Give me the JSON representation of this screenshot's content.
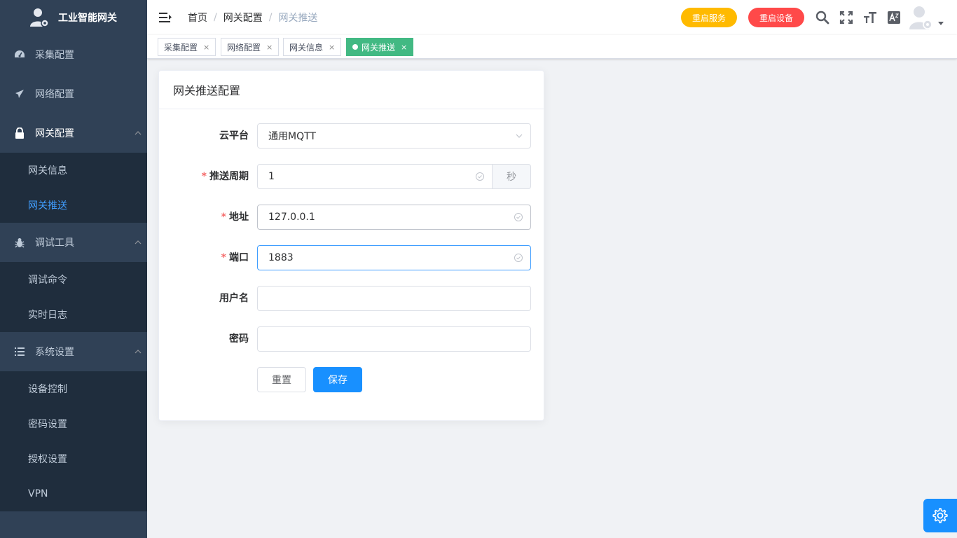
{
  "app": {
    "title": "工业智能网关"
  },
  "sidebar": {
    "items": [
      {
        "label": "采集配置",
        "icon": "dashboard-icon"
      },
      {
        "label": "网络配置",
        "icon": "paper-plane-icon"
      },
      {
        "label": "网关配置",
        "icon": "lock-icon",
        "expanded": true,
        "children": [
          {
            "label": "网关信息"
          },
          {
            "label": "网关推送",
            "active": true
          }
        ]
      },
      {
        "label": "调试工具",
        "icon": "bug-icon",
        "expanded": true,
        "children": [
          {
            "label": "调试命令"
          },
          {
            "label": "实时日志"
          }
        ]
      },
      {
        "label": "系统设置",
        "icon": "list-icon",
        "expanded": true,
        "children": [
          {
            "label": "设备控制"
          },
          {
            "label": "密码设置"
          },
          {
            "label": "授权设置"
          },
          {
            "label": "VPN"
          }
        ]
      }
    ]
  },
  "navbar": {
    "breadcrumb": [
      "首页",
      "网关配置",
      "网关推送"
    ],
    "restart_service": "重启服务",
    "restart_device": "重启设备",
    "tools": [
      "search-icon",
      "fullscreen-icon",
      "font-size-icon",
      "translate-icon"
    ]
  },
  "tags": [
    {
      "label": "采集配置",
      "close": "×"
    },
    {
      "label": "网络配置",
      "close": "×"
    },
    {
      "label": "网关信息",
      "close": "×"
    },
    {
      "label": "网关推送",
      "close": "×",
      "active": true
    }
  ],
  "form": {
    "title": "网关推送配置",
    "cloud": {
      "label": "云平台",
      "value": "通用MQTT"
    },
    "period": {
      "label": "推送周期",
      "value": "1",
      "unit": "秒"
    },
    "address": {
      "label": "地址",
      "value": "127.0.0.1"
    },
    "port": {
      "label": "端口",
      "value": "1883"
    },
    "username": {
      "label": "用户名",
      "value": ""
    },
    "password": {
      "label": "密码",
      "value": ""
    },
    "reset_label": "重置",
    "save_label": "保存",
    "required_mark": "*"
  },
  "colors": {
    "sidebar_bg": "#304156",
    "submenu_bg": "#1f2d3d",
    "active_link": "#409eff",
    "primary": "#1890ff",
    "warning": "#ffba00",
    "danger": "#ff4949",
    "tag_active": "#42b983"
  }
}
